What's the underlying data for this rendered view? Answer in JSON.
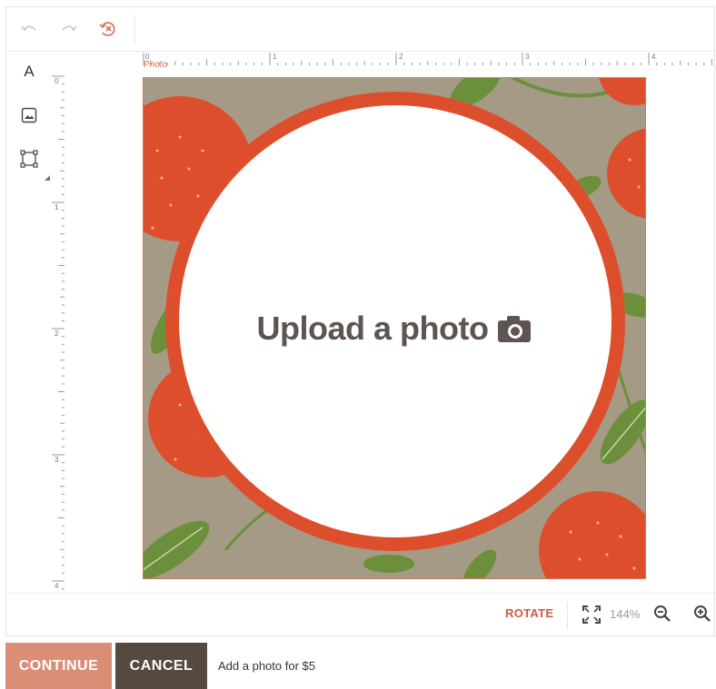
{
  "toolbar": {
    "undo_icon": "undo-icon",
    "redo_icon": "redo-icon",
    "reset_icon": "reset-history-icon"
  },
  "tools": [
    {
      "icon": "text-tool-icon",
      "glyph": "A"
    },
    {
      "icon": "image-tool-icon"
    },
    {
      "icon": "frame-tool-icon"
    }
  ],
  "ruler": {
    "top_labels": [
      "0",
      "1",
      "2",
      "3",
      "4"
    ],
    "left_labels": [
      "0",
      "1",
      "2",
      "3",
      "4"
    ]
  },
  "canvas": {
    "label": "Photo",
    "upload_text": "Upload a photo"
  },
  "bottom": {
    "rotate_label": "ROTATE",
    "zoom_level": "144%"
  },
  "actions": {
    "continue_label": "CONTINUE",
    "cancel_label": "CANCEL",
    "price_note": "Add a photo for $5"
  },
  "colors": {
    "accent": "#d0563b",
    "continue_bg": "#da8e76",
    "cancel_bg": "#544a40",
    "kraft": "#a59a86",
    "orange": "#dd4f2c",
    "leaf": "#6b8f3a"
  }
}
